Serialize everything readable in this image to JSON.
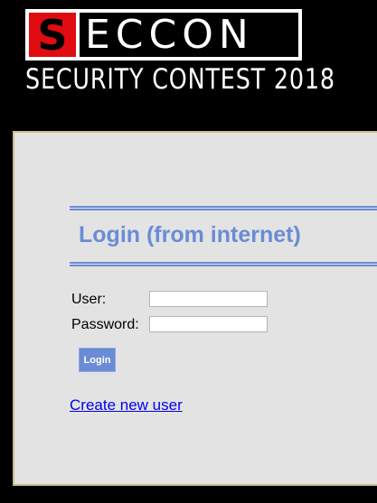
{
  "header": {
    "logo_first_letter": "S",
    "logo_rest": "ECCON",
    "subtitle": "SECURITY CONTEST 2018"
  },
  "login": {
    "title": "Login (from internet)",
    "user_label": "User:",
    "user_value": "",
    "password_label": "Password:",
    "password_value": "",
    "button_label": "Login",
    "create_user_link": "Create new user"
  },
  "colors": {
    "page_background": "#000000",
    "panel_background": "#e3e3e3",
    "panel_border": "#c9c08c",
    "accent_blue": "#6a8cd6",
    "logo_red": "#e10b12",
    "link_blue": "#0000ee"
  }
}
